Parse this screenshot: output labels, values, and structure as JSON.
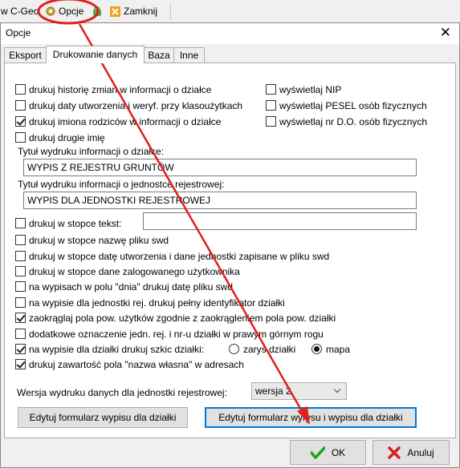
{
  "toolbar": {
    "prefix_label": "w C-Geo",
    "opcje_label": "Opcje",
    "zamknij_label": "Zamknij"
  },
  "dialog": {
    "title": "Opcje",
    "tabs": [
      {
        "label": "Eksport",
        "active": false
      },
      {
        "label": "Drukowanie danych",
        "active": true
      },
      {
        "label": "Baza",
        "active": false
      },
      {
        "label": "Inne",
        "active": false
      }
    ],
    "left_checks": [
      {
        "label": "drukuj historię zmian w informacji o działce",
        "checked": false
      },
      {
        "label": "drukuj daty utworzenia i weryf. przy klasoużytkach",
        "checked": false
      },
      {
        "label": "drukuj imiona rodziców w informacji o działce",
        "checked": true
      },
      {
        "label": "drukuj drugie imię",
        "checked": false
      }
    ],
    "right_checks": [
      {
        "label": "wyświetlaj NIP",
        "checked": false
      },
      {
        "label": "wyświetlaj PESEL osób fizycznych",
        "checked": false
      },
      {
        "label": "wyświetlaj nr D.O. osób fizycznych",
        "checked": false
      }
    ],
    "title_info_label": "Tytuł wydruku informacji o działce:",
    "title_info_value": "WYPIS Z REJESTRU GRUNTÓW",
    "title_unit_label": "Tytuł wydruku informacji o jednostce rejestrowej:",
    "title_unit_value": "WYPIS DLA JEDNOSTKI REJESTROWEJ",
    "footer_text_check": {
      "label": "drukuj w stopce tekst:",
      "checked": false
    },
    "footer_text_value": "",
    "lower_checks": [
      {
        "label": "drukuj w stopce nazwę pliku swd",
        "checked": false
      },
      {
        "label": "drukuj w stopce datę utworzenia i dane jednostki zapisane w pliku swd",
        "checked": false
      },
      {
        "label": "drukuj w stopce dane zalogowanego użytkownika",
        "checked": false
      },
      {
        "label": "na wypisach w polu \"dnia\" drukuj datę pliku swd",
        "checked": false
      },
      {
        "label": "na wypisie dla jednostki rej. drukuj pełny identyfikator działki",
        "checked": false
      },
      {
        "label": "zaokrąglaj pola pow. użytków zgodnie z zaokrągleniem pola pow. działki",
        "checked": true
      },
      {
        "label": "dodatkowe oznaczenie jedn. rej. i nr-u działki w prawym górnym rogu",
        "checked": false
      }
    ],
    "sketch_check": {
      "label": "na wypisie dla działki drukuj szkic działki:",
      "checked": true
    },
    "sketch_options": [
      {
        "label": "zarys działki",
        "selected": false
      },
      {
        "label": "mapa",
        "selected": true
      }
    ],
    "own_name_check": {
      "label": "drukuj zawartość pola \"nazwa własna\" w adresach",
      "checked": true
    },
    "version_label": "Wersja wydruku danych dla jednostki rejestrowej:",
    "version_value": "wersja 2",
    "edit_parcel_button": "Edytuj formularz wypisu dla działki",
    "edit_extract_button": "Edytuj formularz wyrysu i wypisu dla działki",
    "ok_button": "OK",
    "cancel_button": "Anuluj"
  },
  "colors": {
    "annotation": "#e0201c",
    "ok_icon": "#1aa31a",
    "cancel_icon": "#d42020",
    "focus": "#0078d7"
  }
}
